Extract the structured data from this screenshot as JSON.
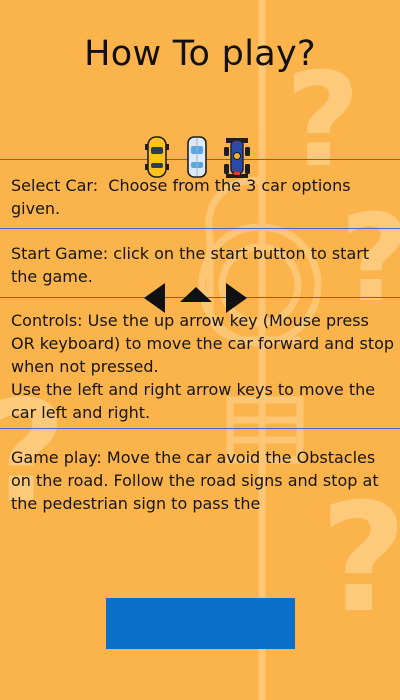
{
  "title": "How To play?",
  "cars": [
    {
      "name": "yellow-car-icon"
    },
    {
      "name": "white-car-icon"
    },
    {
      "name": "race-car-icon"
    }
  ],
  "arrow_icons": [
    "left-arrow-icon",
    "up-arrow-icon",
    "right-arrow-icon"
  ],
  "sections": {
    "select_car": "Select Car:  Choose from the 3 car options given.",
    "start_game": "Start Game: click on the start button to start the game.",
    "controls": "Controls: Use the up arrow key (Mouse press OR keyboard) to move the car forward and stop when not pressed.\nUse the left and right arrow keys to move the car left and right.",
    "game_play": "Game play: Move the car avoid the Obstacles on the road. Follow the road signs and stop at the pedestrian sign to pass the"
  },
  "action_button": {
    "label": ""
  },
  "colors": {
    "background": "#FBB44C",
    "rule": "#4A66C8",
    "button": "#0A70C9"
  }
}
